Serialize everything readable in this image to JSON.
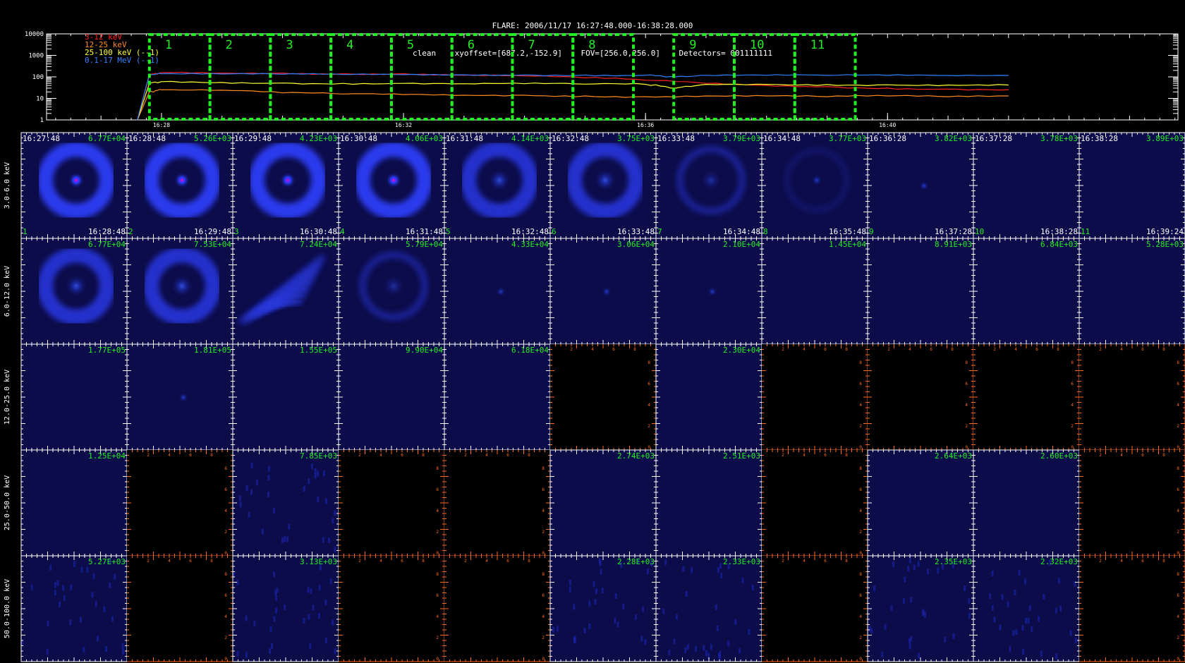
{
  "header": {
    "title_line": "FLARE: 2006/11/17 16:27:48.000-16:38:28.000",
    "info_line": "clean    xyoffset=[687.2,-152.9]    FOV=[256.0,256.0]    Detectors= 001111111"
  },
  "colors": {
    "band_3_12": "#ff2020",
    "band_12_25": "#ff8a1e",
    "band_25_100": "#ffff30",
    "band_100_17000": "#3080ff",
    "interval_box": "#22ee22",
    "panel_label": "#22ee22",
    "empty_axis": "#ff6a20"
  },
  "chart_data": [
    {
      "type": "line",
      "name_key": "lightcurve",
      "yscale": "log",
      "ylim": [
        1,
        10000
      ],
      "ytick_labels": [
        "10000",
        "1000",
        "100",
        "10",
        "1"
      ],
      "ytick_values": [
        10000,
        1000,
        100,
        10,
        1
      ],
      "xlim_minutes": [
        0,
        14.5
      ],
      "xtick_labels": [
        "16:28",
        "16:32",
        "16:36",
        "16:40"
      ],
      "xtick_times": [
        "16:28",
        "16:32",
        "16:36",
        "16:40"
      ],
      "legend": [
        "3-12 keV",
        "12-25 keV",
        "25-100 keV (--1)",
        "0.1-17 MeV (--1)"
      ],
      "legend_placement": "top-left",
      "series": [
        {
          "name": "3-12 keV",
          "color_key": "band_3_12",
          "x_time": [
            "16:27:36",
            "16:27:48",
            "16:28:00",
            "16:29:00",
            "16:30:00",
            "16:31:00",
            "16:32:00",
            "16:33:00",
            "16:34:00",
            "16:35:00",
            "16:36:00",
            "16:37:00",
            "16:38:00",
            "16:39:00",
            "16:40:00",
            "16:41:00",
            "16:42:00"
          ],
          "y": [
            1,
            120,
            160,
            150,
            150,
            140,
            140,
            120,
            110,
            90,
            70,
            50,
            40,
            35,
            30,
            27,
            25
          ]
        },
        {
          "name": "12-25 keV",
          "color_key": "band_12_25",
          "x_time": [
            "16:27:36",
            "16:27:48",
            "16:28:00",
            "16:29:00",
            "16:30:00",
            "16:31:00",
            "16:32:00",
            "16:33:00",
            "16:34:00",
            "16:35:00",
            "16:36:00",
            "16:37:00",
            "16:38:00",
            "16:39:00",
            "16:40:00",
            "16:41:00",
            "16:42:00"
          ],
          "y": [
            1,
            20,
            25,
            24,
            18,
            16,
            15,
            14,
            14,
            13,
            12,
            13,
            13,
            12,
            13,
            12,
            13
          ]
        },
        {
          "name": "25-100 keV (--1)",
          "color_key": "band_25_100",
          "x_time": [
            "16:27:36",
            "16:27:48",
            "16:28:00",
            "16:29:00",
            "16:30:00",
            "16:31:00",
            "16:32:00",
            "16:33:00",
            "16:34:00",
            "16:35:00",
            "16:36:00",
            "16:36:30",
            "16:37:00",
            "16:38:00",
            "16:39:00",
            "16:40:00",
            "16:41:00",
            "16:42:00"
          ],
          "y": [
            1,
            50,
            60,
            55,
            52,
            50,
            50,
            48,
            48,
            46,
            45,
            30,
            45,
            45,
            44,
            43,
            42,
            42
          ]
        },
        {
          "name": "0.1-17 MeV (--1)",
          "color_key": "band_100_17000",
          "x_time": [
            "16:27:36",
            "16:27:48",
            "16:28:00",
            "16:29:00",
            "16:30:00",
            "16:31:00",
            "16:32:00",
            "16:33:00",
            "16:34:00",
            "16:35:00",
            "16:36:00",
            "16:36:30",
            "16:37:00",
            "16:38:00",
            "16:39:00",
            "16:40:00",
            "16:41:00",
            "16:42:00"
          ],
          "y": [
            1,
            130,
            140,
            135,
            132,
            128,
            126,
            125,
            124,
            123,
            120,
            100,
            118,
            118,
            117,
            116,
            116,
            116
          ]
        }
      ],
      "intervals": [
        {
          "label": "1",
          "start": "16:27:48",
          "end": "16:28:48"
        },
        {
          "label": "2",
          "start": "16:28:48",
          "end": "16:29:48"
        },
        {
          "label": "3",
          "start": "16:29:48",
          "end": "16:30:48"
        },
        {
          "label": "4",
          "start": "16:30:48",
          "end": "16:31:48"
        },
        {
          "label": "5",
          "start": "16:31:48",
          "end": "16:32:48"
        },
        {
          "label": "6",
          "start": "16:32:48",
          "end": "16:33:48"
        },
        {
          "label": "7",
          "start": "16:33:48",
          "end": "16:34:48"
        },
        {
          "label": "8",
          "start": "16:34:48",
          "end": "16:35:48"
        },
        {
          "label": "9",
          "start": "16:36:28",
          "end": "16:37:28"
        },
        {
          "label": "10",
          "start": "16:37:28",
          "end": "16:38:28"
        },
        {
          "label": "11",
          "start": "16:38:28",
          "end": "16:39:28"
        }
      ]
    },
    {
      "type": "heatmap",
      "name_key": "image_grid",
      "energy_bands": [
        "3.0-6.0 keV",
        "6.0-12.0 keV",
        "12.0-25.0 keV",
        "25.0-50.0 keV",
        "50.0-100.0 keV"
      ],
      "start_times": [
        "16:27:48",
        "16:28:48",
        "16:29:48",
        "16:30:48",
        "16:31:48",
        "16:32:48",
        "16:33:48",
        "16:34:48",
        "16:36:28",
        "16:37:28",
        "16:38:28"
      ],
      "end_times": [
        "16:28:48",
        "16:29:48",
        "16:30:48",
        "16:31:48",
        "16:32:48",
        "16:33:48",
        "16:34:48",
        "16:35:48",
        "16:37:28",
        "16:38:28",
        "16:39:24"
      ],
      "interval_numbers": [
        "1",
        "2",
        "3",
        "4",
        "5",
        "6",
        "7",
        "8",
        "9",
        "10",
        "11"
      ],
      "empty_axis_ticks": [
        "0",
        "2",
        "4",
        "6",
        "8"
      ],
      "max_values": [
        [
          "6.77E+04",
          "5.26E+03",
          "4.23E+03",
          "4.06E+03",
          "4.14E+03",
          "3.75E+03",
          "3.79E+03",
          "3.77E+03",
          "3.82E+03",
          "3.78E+03",
          "3.89E+03"
        ],
        [
          "6.77E+04",
          "7.53E+04",
          "7.24E+04",
          "5.79E+04",
          "4.33E+04",
          "3.06E+04",
          "2.10E+04",
          "1.45E+04",
          "8.91E+03",
          "6.84E+03",
          "5.28E+03"
        ],
        [
          "1.77E+05",
          "1.81E+05",
          "1.55E+05",
          "9.90E+04",
          "6.18E+04",
          null,
          "2.30E+04",
          null,
          null,
          null,
          null
        ],
        [
          "1.25E+04",
          null,
          "7.85E+03",
          null,
          null,
          "2.74E+03",
          "2.51E+03",
          null,
          "2.64E+03",
          "2.60E+03",
          null
        ],
        [
          "5.27E+03",
          null,
          "3.13E+03",
          null,
          null,
          "2.28E+03",
          "2.33E+03",
          null,
          "2.35E+03",
          "2.32E+03",
          null
        ]
      ],
      "morphology": [
        [
          "ring-core",
          "ring-core",
          "ring-core",
          "ring-core",
          "ring",
          "ring",
          "ring-faint",
          "faint",
          "dot",
          "blank",
          "blank"
        ],
        [
          "ring",
          "ring",
          "streaks",
          "ring-faint",
          "dot",
          "dot",
          "dot",
          "blank",
          "blank",
          "blank",
          "blank"
        ],
        [
          "blank",
          "dot",
          "blank",
          "blank",
          "blank",
          null,
          "blank",
          null,
          null,
          null,
          null
        ],
        [
          "blank",
          null,
          "noise",
          null,
          null,
          "blank",
          "blank",
          null,
          "blank",
          "blank",
          null
        ],
        [
          "noise",
          null,
          "noise",
          null,
          null,
          "noise",
          "noise",
          null,
          "noise",
          "noise",
          null
        ]
      ]
    }
  ]
}
